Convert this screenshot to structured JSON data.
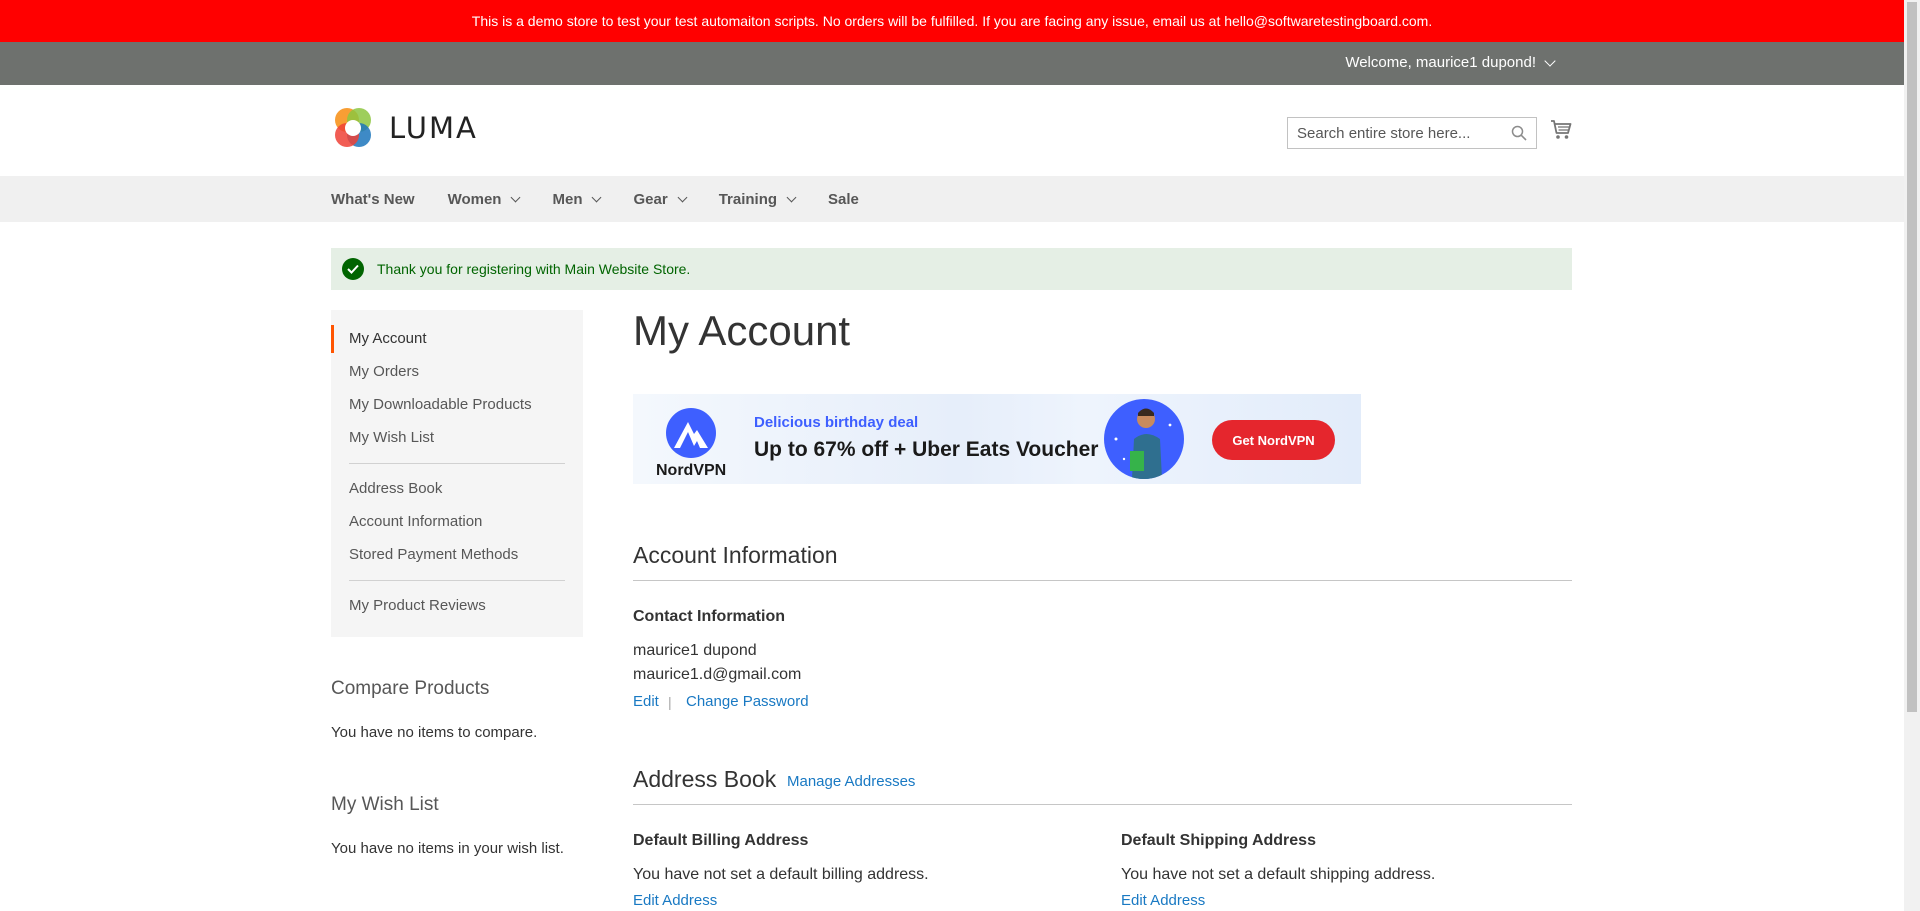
{
  "demo_notice": "This is a demo store to test your test automaiton scripts. No orders will be fulfilled. If you are facing any issue, email us at hello@softwaretestingboard.com.",
  "top_header": {
    "welcome": "Welcome, maurice1 dupond!"
  },
  "logo": {
    "text": "LUMA"
  },
  "search": {
    "placeholder": "Search entire store here..."
  },
  "nav": {
    "items": [
      {
        "label": "What's New",
        "has_dropdown": false
      },
      {
        "label": "Women",
        "has_dropdown": true
      },
      {
        "label": "Men",
        "has_dropdown": true
      },
      {
        "label": "Gear",
        "has_dropdown": true
      },
      {
        "label": "Training",
        "has_dropdown": true
      },
      {
        "label": "Sale",
        "has_dropdown": false
      }
    ]
  },
  "message": {
    "success": "Thank you for registering with Main Website Store."
  },
  "sidebar": {
    "groups": [
      [
        "My Account",
        "My Orders",
        "My Downloadable Products",
        "My Wish List"
      ],
      [
        "Address Book",
        "Account Information",
        "Stored Payment Methods"
      ],
      [
        "My Product Reviews"
      ]
    ],
    "active": "My Account",
    "compare": {
      "title": "Compare Products",
      "empty": "You have no items to compare."
    },
    "wishlist": {
      "title": "My Wish List",
      "empty": "You have no items in your wish list."
    }
  },
  "page": {
    "title": "My Account"
  },
  "ad": {
    "brand": "NordVPN",
    "deal": "Delicious birthday deal",
    "headline": "Up to 67% off + Uber Eats Voucher",
    "cta": "Get NordVPN",
    "brand_color": "#3e5fff",
    "cta_color": "#e5262d"
  },
  "account_info": {
    "title": "Account Information",
    "contact_title": "Contact Information",
    "name": "maurice1 dupond",
    "email": "maurice1.d@gmail.com",
    "edit": "Edit",
    "separator": "|",
    "change_password": "Change Password"
  },
  "address_book": {
    "title": "Address Book",
    "manage": "Manage Addresses",
    "billing": {
      "title": "Default Billing Address",
      "text": "You have not set a default billing address.",
      "link": "Edit Address"
    },
    "shipping": {
      "title": "Default Shipping Address",
      "text": "You have not set a default shipping address.",
      "link": "Edit Address"
    }
  },
  "colors": {
    "demo_bar": "#ff0000",
    "top_header": "#6e716e",
    "nav_bg": "#f0f0f0",
    "success_bg": "#e5efe5",
    "success_text": "#006400",
    "link": "#1979c3",
    "active_marker": "#ff5501"
  }
}
